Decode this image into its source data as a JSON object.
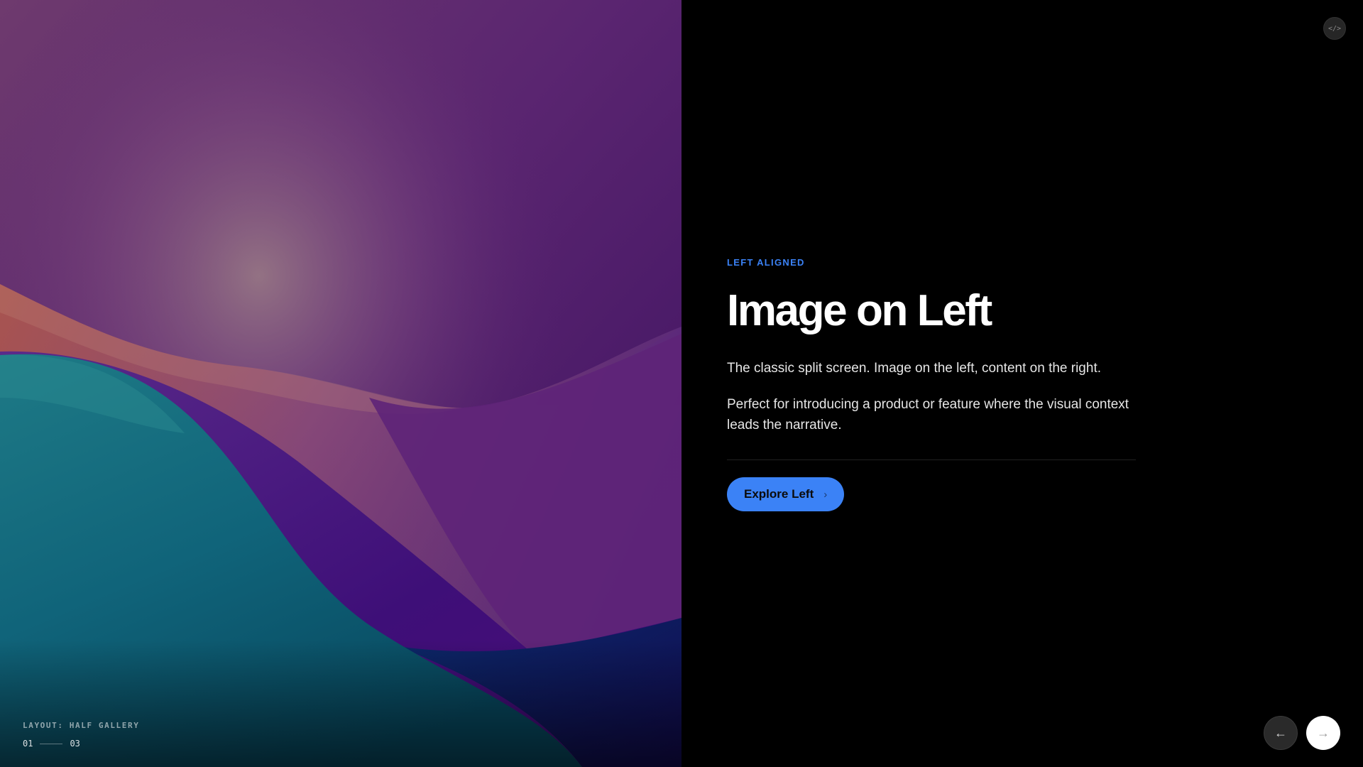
{
  "gallery": {
    "layout_label": "LAYOUT: HALF GALLERY",
    "counter_current": "01",
    "counter_total": "03"
  },
  "content": {
    "eyebrow": "LEFT ALIGNED",
    "title": "Image on Left",
    "paragraph_1": "The classic split screen. Image on the left, content on the right.",
    "paragraph_2": "Perfect for introducing a product or feature where the visual context leads the narrative.",
    "cta_label": "Explore Left",
    "cta_icon": "chevron-right-icon"
  },
  "controls": {
    "code_toggle_glyph": "</>",
    "prev_glyph": "←",
    "next_glyph": "→"
  },
  "colors": {
    "accent": "#3b82f6",
    "background": "#000000"
  }
}
